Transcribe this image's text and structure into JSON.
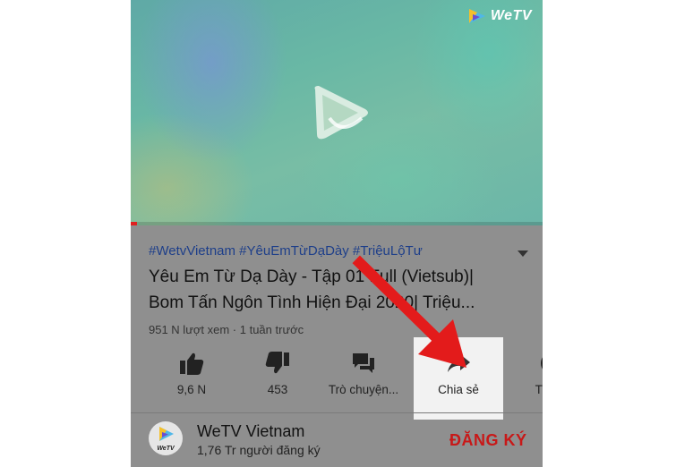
{
  "player": {
    "logo_text": "WeTV",
    "progress": 0.015
  },
  "video": {
    "hashtags": "#WetvVietnam #YêuEmTừDạDày #TriệuLộTư",
    "title_line1": "Yêu Em Từ Dạ Dày - Tập 01 Full (Vietsub)|",
    "title_line2": "Bom Tấn Ngôn Tình Hiện Đại 2020| Triệu...",
    "meta": "951 N lượt xem · 1 tuần trước"
  },
  "actions": {
    "like": "9,6 N",
    "dislike": "453",
    "chat": "Trò chuyện...",
    "share": "Chia sẻ",
    "download": "Tải xu"
  },
  "channel": {
    "avatar_text": "WeTV",
    "name": "WeTV Vietnam",
    "subscribers": "1,76 Tr người đăng ký",
    "subscribe_label": "ĐĂNG KÝ"
  },
  "colors": {
    "accent_red": "#c81818",
    "hashtag_blue": "#1e3f8a",
    "annotation_arrow": "#e31b1b"
  }
}
